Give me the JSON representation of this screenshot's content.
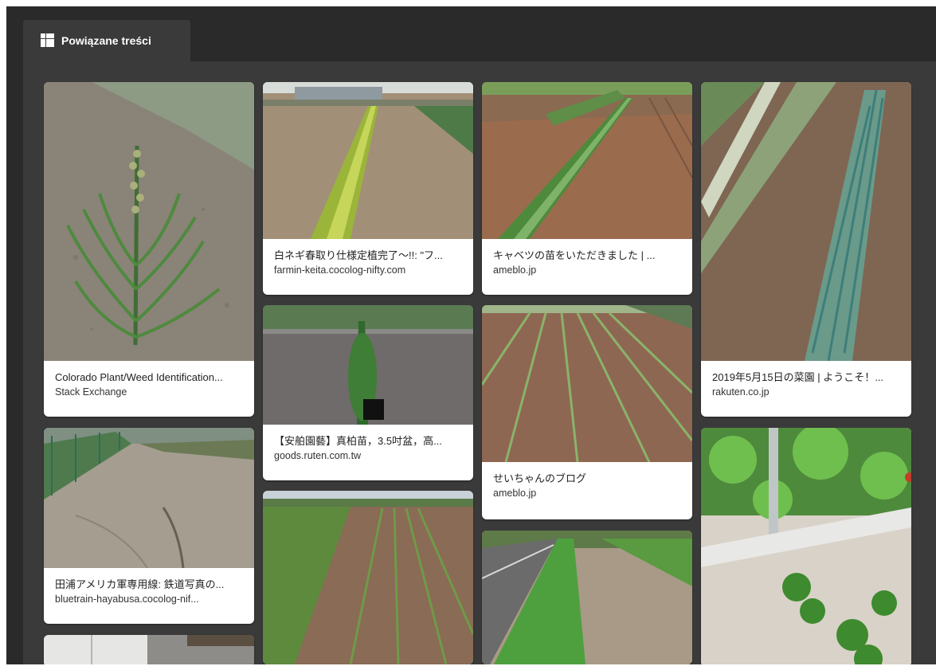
{
  "panel": {
    "tab_label": "Powiązane treści",
    "tab_icon": "grid-icon"
  },
  "cards": [
    {
      "title": "Colorado Plant/Weed Identification...",
      "source": "Stack Exchange",
      "image": "weed-plant-image"
    },
    {
      "title": "田浦アメリカ軍専用線: 鉄道写真の...",
      "source": "bluetrain-hayabusa.cocolog-nif...",
      "image": "railway-path-image"
    },
    {
      "title": "",
      "source": "",
      "image": "shed-image"
    },
    {
      "title": "白ネギ春取り仕様定植完了～!!: \"フ...",
      "source": "farmin-keita.cocolog-nifty.com",
      "image": "leek-row-image"
    },
    {
      "title": "【安舶園藝】真柏苗，3.5吋盆，高...",
      "source": "goods.ruten.com.tw",
      "image": "juniper-sapling-image"
    },
    {
      "title": "",
      "source": "",
      "image": "field-rows-image"
    },
    {
      "title": "キャベツの苗をいただきました | ...",
      "source": "ameblo.jp",
      "image": "onion-row-image"
    },
    {
      "title": "せいちゃんのブログ",
      "source": "ameblo.jp",
      "image": "field-furrows-image"
    },
    {
      "title": "",
      "source": "",
      "image": "roadside-image"
    },
    {
      "title": "2019年5月15日の菜園 | ようこそ！...",
      "source": "rakuten.co.jp",
      "image": "green-onion-image"
    },
    {
      "title": "",
      "source": "",
      "image": "tomato-plant-image"
    }
  ]
}
